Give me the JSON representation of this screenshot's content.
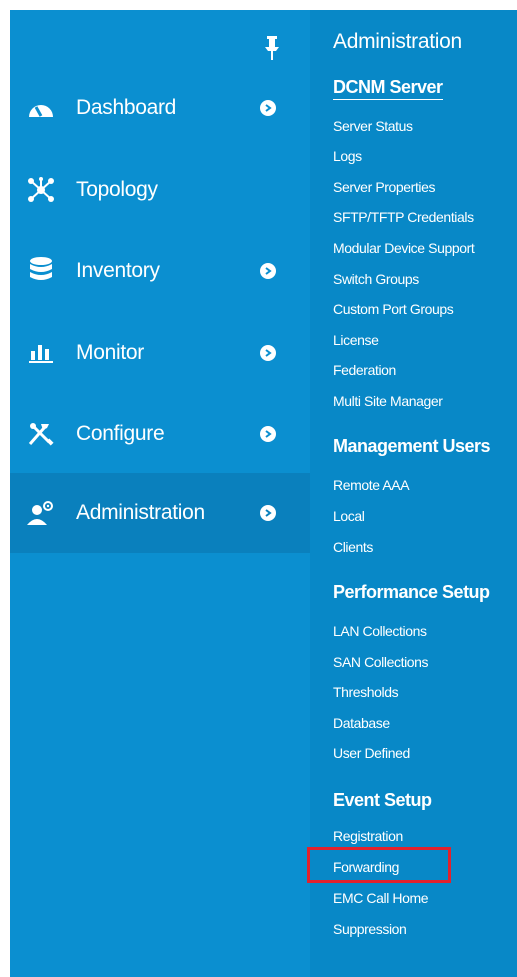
{
  "left_nav": {
    "items": [
      {
        "label": "Dashboard",
        "icon": "dashboard-gauge-icon",
        "has_submenu": true
      },
      {
        "label": "Topology",
        "icon": "topology-icon",
        "has_submenu": false
      },
      {
        "label": "Inventory",
        "icon": "database-icon",
        "has_submenu": true
      },
      {
        "label": "Monitor",
        "icon": "bar-chart-icon",
        "has_submenu": true
      },
      {
        "label": "Configure",
        "icon": "tools-icon",
        "has_submenu": true
      },
      {
        "label": "Administration",
        "icon": "admin-user-gear-icon",
        "has_submenu": true,
        "active": true
      }
    ]
  },
  "submenu": {
    "title": "Administration",
    "sections": [
      {
        "heading": "DCNM Server",
        "items": [
          "Server Status",
          "Logs",
          "Server Properties",
          "SFTP/TFTP Credentials",
          "Modular Device Support",
          "Switch Groups",
          "Custom Port Groups",
          "License",
          "Federation",
          "Multi Site Manager"
        ]
      },
      {
        "heading": "Management Users",
        "items": [
          "Remote AAA",
          "Local",
          "Clients"
        ]
      },
      {
        "heading": "Performance Setup",
        "items": [
          "LAN Collections",
          "SAN Collections",
          "Thresholds",
          "Database",
          "User Defined"
        ]
      },
      {
        "heading": "Event Setup",
        "items": [
          "Registration",
          "Forwarding",
          "EMC Call Home",
          "Suppression"
        ]
      }
    ]
  },
  "colors": {
    "nav_bg": "#0b8fd0",
    "active_bg": "#0a80bd",
    "submenu_bg": "#0888c7",
    "highlight_border": "#e3222d"
  }
}
